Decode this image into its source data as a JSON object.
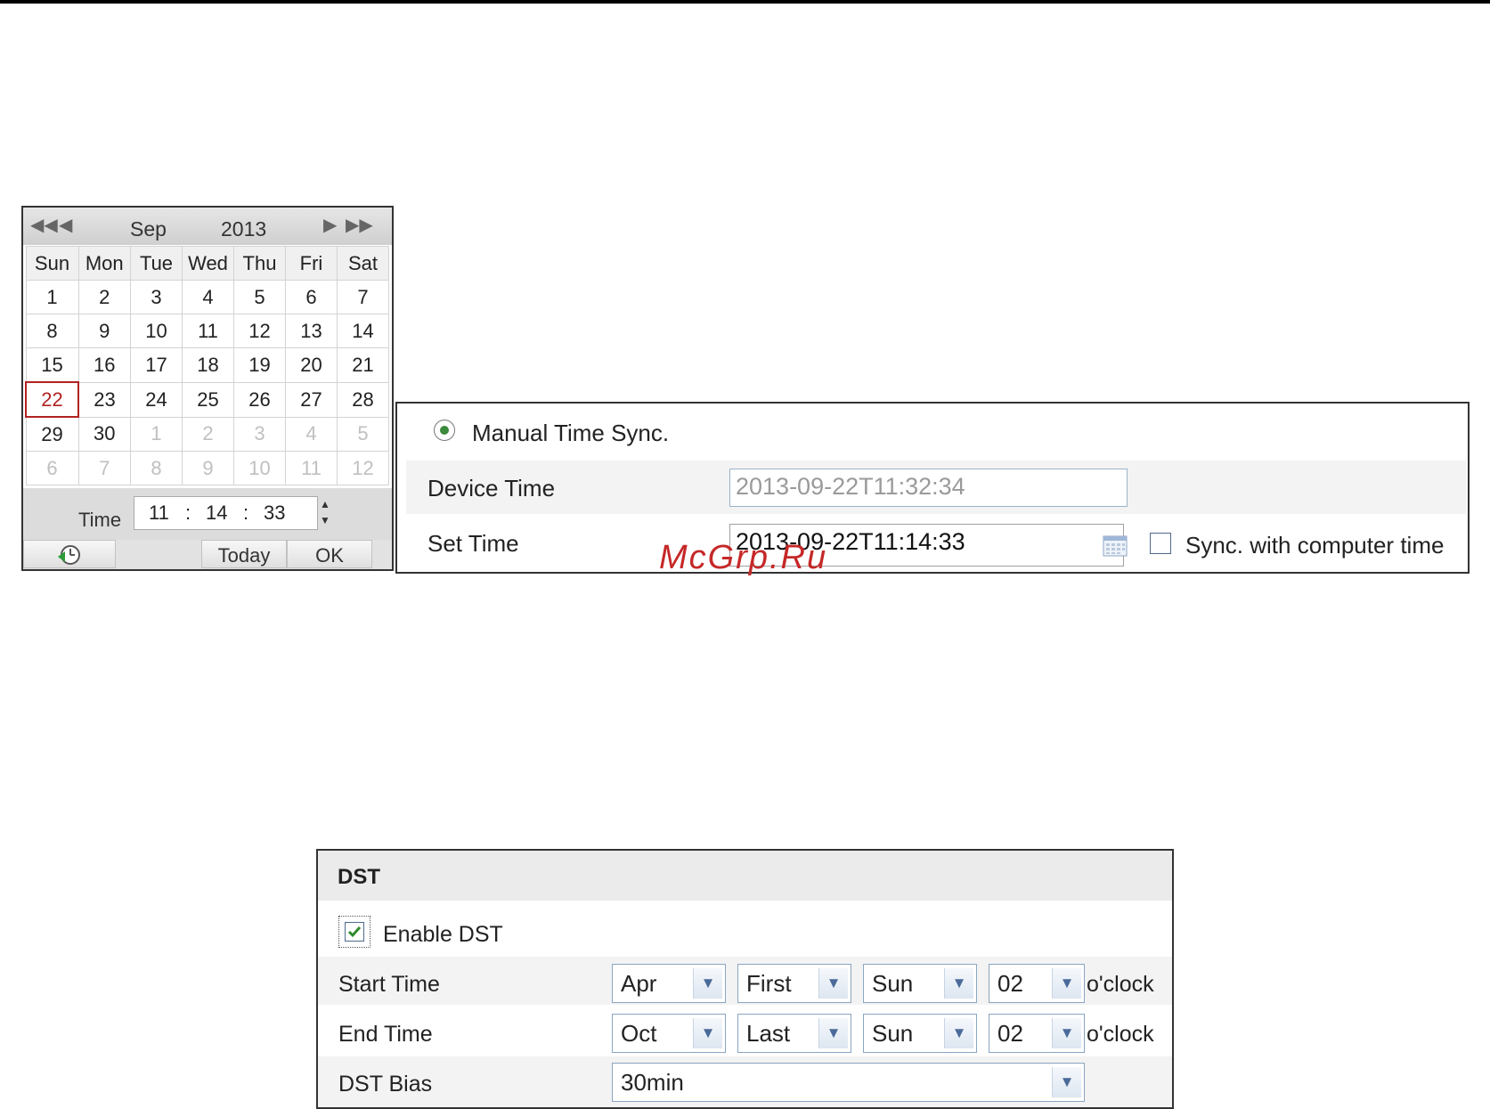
{
  "calendar": {
    "nav": {
      "prev_year": "◀◀",
      "prev_month": "◀",
      "next_month": "▶",
      "next_year": "▶▶"
    },
    "month": "Sep",
    "year": "2013",
    "weekdays": [
      "Sun",
      "Mon",
      "Tue",
      "Wed",
      "Thu",
      "Fri",
      "Sat"
    ],
    "weeks": [
      [
        {
          "d": "1"
        },
        {
          "d": "2"
        },
        {
          "d": "3"
        },
        {
          "d": "4"
        },
        {
          "d": "5"
        },
        {
          "d": "6"
        },
        {
          "d": "7"
        }
      ],
      [
        {
          "d": "8"
        },
        {
          "d": "9"
        },
        {
          "d": "10"
        },
        {
          "d": "11"
        },
        {
          "d": "12"
        },
        {
          "d": "13"
        },
        {
          "d": "14"
        }
      ],
      [
        {
          "d": "15"
        },
        {
          "d": "16"
        },
        {
          "d": "17"
        },
        {
          "d": "18"
        },
        {
          "d": "19"
        },
        {
          "d": "20"
        },
        {
          "d": "21"
        }
      ],
      [
        {
          "d": "22",
          "selected": true
        },
        {
          "d": "23"
        },
        {
          "d": "24"
        },
        {
          "d": "25"
        },
        {
          "d": "26"
        },
        {
          "d": "27"
        },
        {
          "d": "28"
        }
      ],
      [
        {
          "d": "29"
        },
        {
          "d": "30"
        },
        {
          "d": "1",
          "other": true
        },
        {
          "d": "2",
          "other": true
        },
        {
          "d": "3",
          "other": true
        },
        {
          "d": "4",
          "other": true
        },
        {
          "d": "5",
          "other": true
        }
      ],
      [
        {
          "d": "6",
          "other": true
        },
        {
          "d": "7",
          "other": true
        },
        {
          "d": "8",
          "other": true
        },
        {
          "d": "9",
          "other": true
        },
        {
          "d": "10",
          "other": true
        },
        {
          "d": "11",
          "other": true
        },
        {
          "d": "12",
          "other": true
        }
      ]
    ],
    "time_label": "Time",
    "hour": "11",
    "minute": "14",
    "second": "33",
    "sep": ":",
    "spin_up": "▲",
    "spin_down": "▼",
    "today_label": "Today",
    "ok_label": "OK"
  },
  "sync": {
    "manual_label": "Manual Time Sync.",
    "device_time_label": "Device Time",
    "device_time_value": "2013-09-22T11:32:34",
    "set_time_label": "Set Time",
    "set_time_value": "2013-09-22T11:14:33",
    "sync_computer_label": "Sync. with computer time",
    "sync_computer_checked": false
  },
  "watermark": "McGrp.Ru",
  "dst": {
    "title": "DST",
    "enable_label": "Enable DST",
    "enable_checked": true,
    "start_label": "Start Time",
    "start": {
      "month": "Apr",
      "week": "First",
      "day": "Sun",
      "hour": "02"
    },
    "end_label": "End Time",
    "end": {
      "month": "Oct",
      "week": "Last",
      "day": "Sun",
      "hour": "02"
    },
    "oclock": "o'clock",
    "bias_label": "DST Bias",
    "bias_value": "30min",
    "dropdown_arrow": "▼"
  },
  "colors": {
    "selected_day": "#b22222",
    "radio_dot": "#3c8a3c",
    "check_mark": "#2e8b2e",
    "watermark": "#c62828"
  }
}
